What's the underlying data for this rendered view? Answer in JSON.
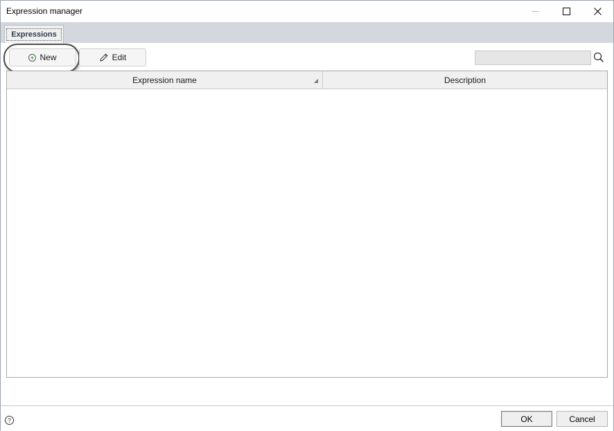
{
  "window": {
    "title": "Expression manager"
  },
  "tabs": [
    {
      "label": "Expressions",
      "active": true
    }
  ],
  "toolbar": {
    "new_label": "New",
    "edit_label": "Edit",
    "search_placeholder": "",
    "search_value": ""
  },
  "grid": {
    "columns": [
      {
        "label": "Expression name",
        "sorted": true
      },
      {
        "label": "Description"
      }
    ],
    "rows": []
  },
  "footer": {
    "help_label": "?",
    "ok_label": "OK",
    "cancel_label": "Cancel"
  },
  "icons": {
    "new": "plus-circle-icon",
    "edit": "pencil-icon",
    "search": "search-icon",
    "help": "help-icon"
  },
  "colors": {
    "tab_strip": "#d4d8de",
    "new_icon_plus": "#4caf50"
  }
}
